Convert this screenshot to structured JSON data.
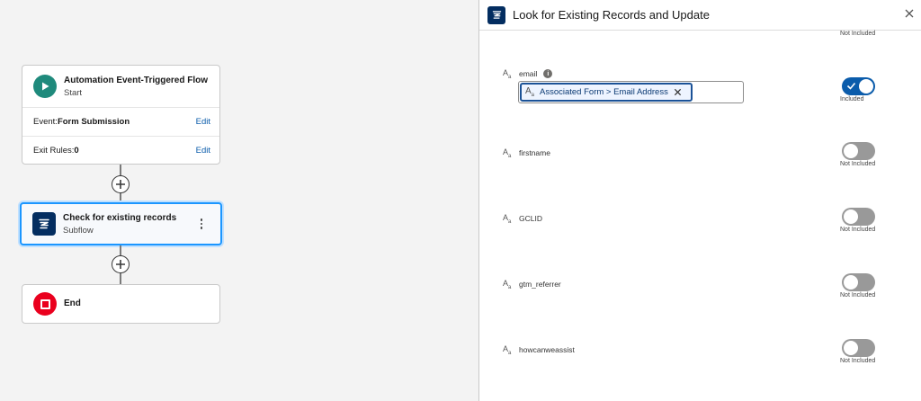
{
  "canvas": {
    "start_node": {
      "title": "Automation Event-Triggered Flow",
      "subtitle": "Start",
      "event_label": "Event:",
      "event_value": "Form Submission",
      "exit_label": "Exit Rules:",
      "exit_value": "0",
      "edit_label": "Edit"
    },
    "subflow_node": {
      "title": "Check for existing records",
      "subtitle": "Subflow"
    },
    "end_node": {
      "title": "End"
    }
  },
  "panel": {
    "title": "Look for Existing Records and Update",
    "top_status": "Not Included",
    "fields": [
      {
        "name": "email",
        "icon": "text-field-icon",
        "included": true,
        "status": "Included",
        "value_pill": "Associated Form > Email Address"
      },
      {
        "name": "firstname",
        "icon": "text-field-icon",
        "included": false,
        "status": "Not Included"
      },
      {
        "name": "GCLID",
        "icon": "text-field-icon",
        "included": false,
        "status": "Not Included"
      },
      {
        "name": "gtm_referrer",
        "icon": "text-field-icon",
        "included": false,
        "status": "Not Included"
      },
      {
        "name": "howcanweassist",
        "icon": "text-field-icon",
        "included": false,
        "status": "Not Included"
      }
    ]
  },
  "colors": {
    "start_icon": "#1f8a7c",
    "subflow_icon": "#032d60",
    "end_icon": "#ea001e",
    "toggle_on": "#0b5cab",
    "toggle_off": "#999999",
    "selection": "#1b96ff"
  }
}
